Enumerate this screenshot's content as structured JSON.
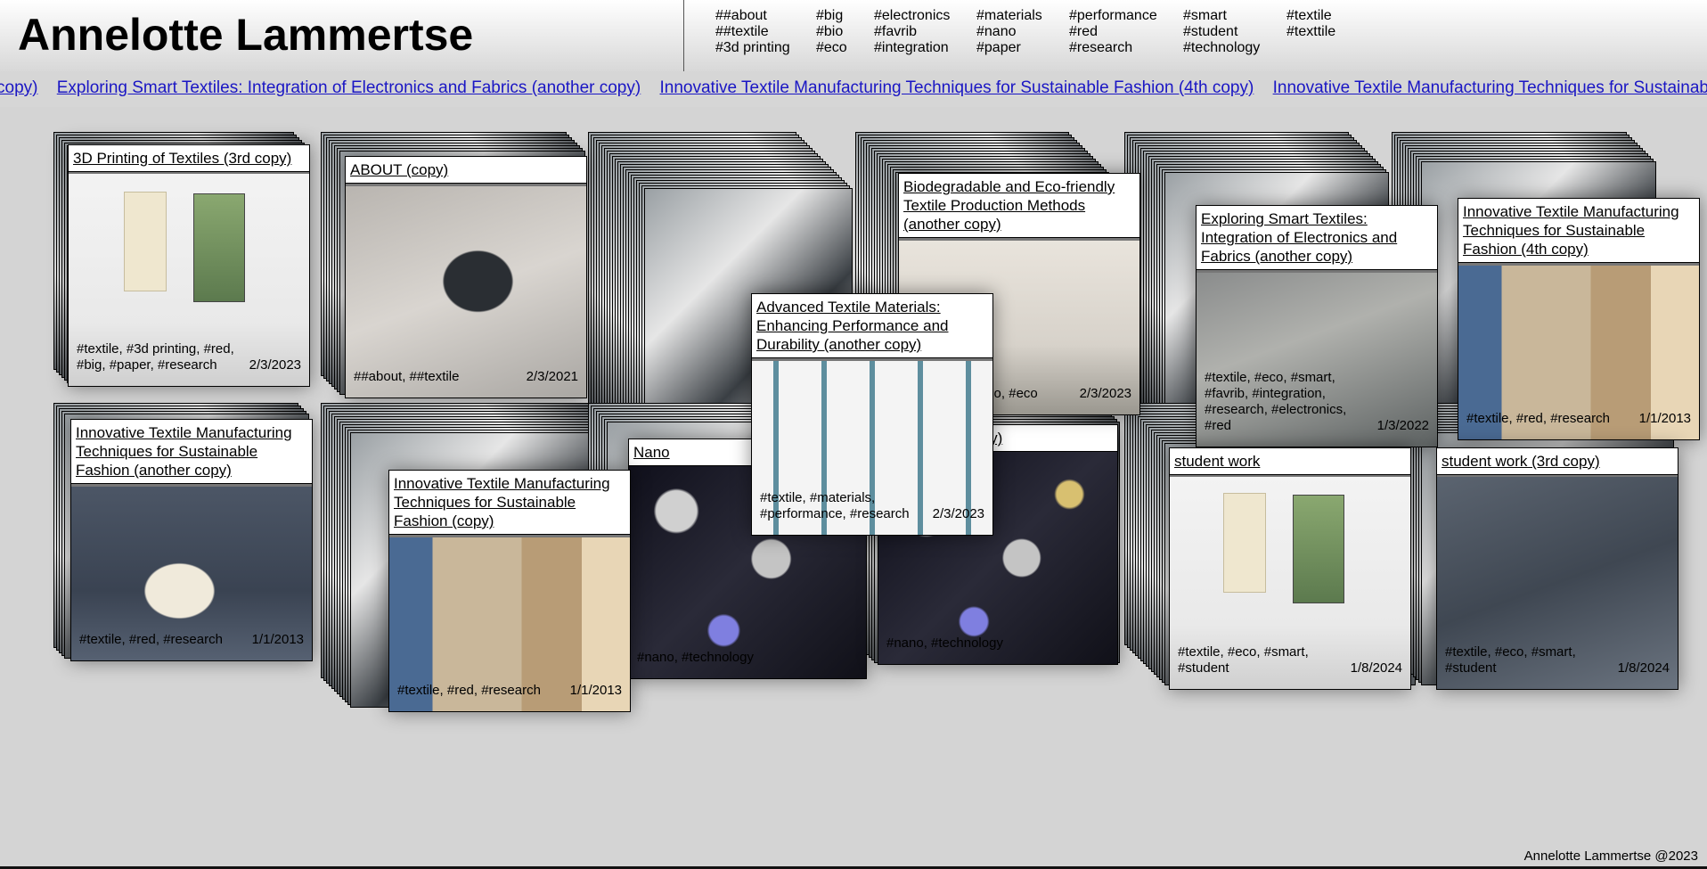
{
  "site": {
    "title": "Annelotte Lammertse",
    "footer": "Annelotte Lammertse @2023"
  },
  "tags": [
    [
      "##about",
      "##textile",
      "#3d printing"
    ],
    [
      "#big",
      "#bio",
      "#eco"
    ],
    [
      "#electronics",
      "#favrib",
      "#integration"
    ],
    [
      "#materials",
      "#nano",
      "#paper"
    ],
    [
      "#performance",
      "#red",
      "#research"
    ],
    [
      "#smart",
      "#student",
      "#technology"
    ],
    [
      "#textile",
      "#texttile"
    ]
  ],
  "ticker": [
    "copy)",
    "Exploring Smart Textiles: Integration of Electronics and Fabrics (another copy)",
    "Innovative Textile Manufacturing Techniques for Sustainable Fashion (4th copy)",
    "Innovative Textile Manufacturing Techniques for Sustainable Fashion (a"
  ],
  "cards": [
    {
      "title": "3D Printing of Textiles (3rd copy)",
      "tags": "#textile, #3d printing, #red, #big, #paper, #research",
      "date": "2/3/2023"
    },
    {
      "title": "ABOUT (copy)",
      "tags": "##about, ##textile",
      "date": "2/3/2021"
    },
    {
      "title": "Biodegradable and Eco-friendly Textile Production Methods (another copy)",
      "tags": "#materials, #bio, #eco",
      "date": "2/3/2023"
    },
    {
      "title": "Exploring Smart Textiles: Integration of Electronics and Fabrics (another copy)",
      "tags": "#textile, #eco, #smart, #favrib, #integration, #research, #electronics, #red",
      "date": "1/3/2022"
    },
    {
      "title": "Innovative Textile Manufacturing Techniques for Sustainable Fashion (4th copy)",
      "tags": "#textile, #red, #research",
      "date": "1/1/2013"
    },
    {
      "title": "Innovative Textile Manufacturing Techniques for Sustainable Fashion (another copy)",
      "tags": "#textile, #red, #research",
      "date": "1/1/2013"
    },
    {
      "title": "Innovative Textile Manufacturing Techniques for Sustainable Fashion (copy)",
      "tags": "#textile, #red, #research",
      "date": "1/1/2013"
    },
    {
      "title": "Nano",
      "tags": "#nano, #technology",
      "date": ""
    },
    {
      "title": "(copy)",
      "tags": "#nano, #technology",
      "date": ""
    },
    {
      "title": "Advanced Textile Materials: Enhancing Performance and Durability (another copy)",
      "tags": "#textile, #materials, #performance, #research",
      "date": "2/3/2023"
    },
    {
      "title": "student work",
      "tags": "#textile, #eco, #smart, #student",
      "date": "1/8/2024"
    },
    {
      "title": "student work (3rd copy)",
      "tags": "#textile, #eco, #smart, #student",
      "date": "1/8/2024"
    }
  ]
}
